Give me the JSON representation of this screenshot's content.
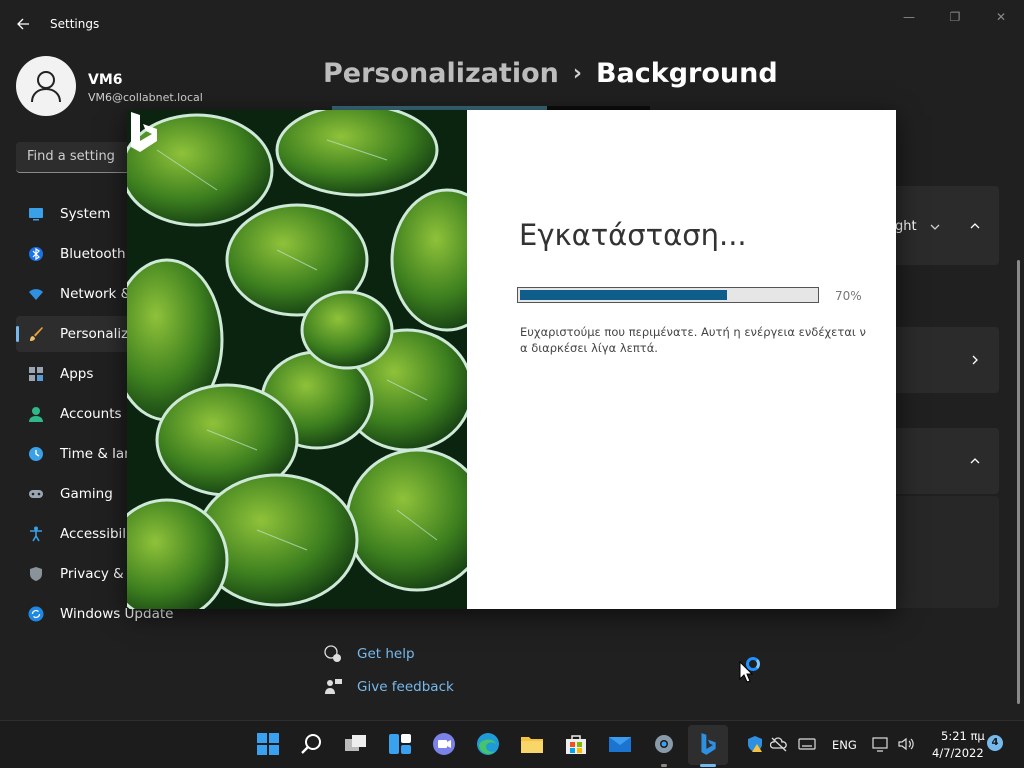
{
  "window": {
    "title": "Settings",
    "minimize": "—",
    "maximize": "❐",
    "close": "✕"
  },
  "user": {
    "name": "VM6",
    "email": "VM6@collabnet.local"
  },
  "search": {
    "placeholder": "Find a setting"
  },
  "nav": {
    "items": [
      {
        "label": "System",
        "icon": "system-icon"
      },
      {
        "label": "Bluetooth &",
        "icon": "bluetooth-icon"
      },
      {
        "label": "Network &",
        "icon": "network-icon"
      },
      {
        "label": "Personaliza",
        "icon": "brush-icon",
        "active": true
      },
      {
        "label": "Apps",
        "icon": "apps-icon"
      },
      {
        "label": "Accounts",
        "icon": "accounts-icon"
      },
      {
        "label": "Time & lan",
        "icon": "clock-icon"
      },
      {
        "label": "Gaming",
        "icon": "gamepad-icon"
      },
      {
        "label": "Accessibilit",
        "icon": "accessibility-icon"
      },
      {
        "label": "Privacy & s",
        "icon": "shield-icon"
      },
      {
        "label": "Windows Update",
        "icon": "update-icon"
      }
    ]
  },
  "breadcrumb": {
    "parent": "Personalization",
    "separator": "›",
    "current": "Background"
  },
  "cards": {
    "fit_value": "ght"
  },
  "help": {
    "get_help": "Get help",
    "give_feedback": "Give feedback"
  },
  "installer": {
    "title": "Εγκατάσταση...",
    "progress": 70,
    "progress_label": "70%",
    "message": "Ευχαριστούμε που περιμένατε. Αυτή η ενέργεια ενδέχεται να διαρκέσει λίγα λεπτά."
  },
  "taskbar": {
    "apps": [
      "start-icon",
      "search-icon",
      "task-view-icon",
      "widgets-icon",
      "teams-chat-icon",
      "edge-icon",
      "file-explorer-icon",
      "store-icon",
      "mail-icon",
      "settings-icon",
      "bing-icon"
    ],
    "language": "ENG",
    "time": "5:21 πμ",
    "date": "4/7/2022",
    "notifications": "4"
  },
  "colors": {
    "accent": "#76b9ed",
    "progress": "#0e5d8a",
    "background": "#202020",
    "card": "#2b2b2b"
  }
}
